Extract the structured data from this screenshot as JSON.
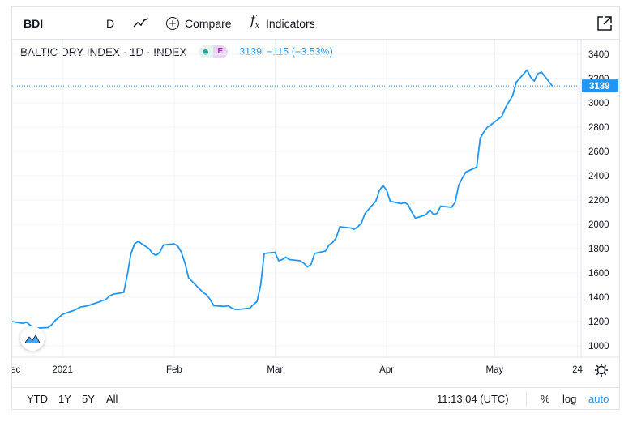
{
  "toolbar": {
    "symbol": "BDI",
    "interval": "D",
    "compare_label": "Compare",
    "indicators_label": "Indicators",
    "chart_type_icon": "line-chart-icon",
    "fullscreen_icon": "external-link-icon"
  },
  "legend": {
    "title": "BALTIC DRY INDEX · 1D · INDEX",
    "badge": "E",
    "last": "3139",
    "change": "−115 (−3.53%)"
  },
  "price_scale": {
    "current_label": "3139"
  },
  "bottom_bar": {
    "ranges": [
      "YTD",
      "1Y",
      "5Y",
      "All"
    ],
    "time": "11:13:04 (UTC)",
    "percent_label": "%",
    "log_label": "log",
    "auto_label": "auto",
    "settings_icon": "gear-icon"
  },
  "colors": {
    "line": "#2196f3",
    "accent": "#2196f3",
    "grid": "#f0f3fa"
  },
  "chart_data": {
    "type": "line",
    "title": "BALTIC DRY INDEX",
    "ylim": [
      900,
      3500
    ],
    "xlim": [
      "2020-12-18",
      "2021-05-25"
    ],
    "yticks": [
      1000,
      1200,
      1400,
      1600,
      1800,
      2000,
      2200,
      2400,
      2600,
      2800,
      3000,
      3200,
      3400
    ],
    "xticks": [
      {
        "date": "2020-12-18",
        "label": "Dec"
      },
      {
        "date": "2021-01-01",
        "label": "2021"
      },
      {
        "date": "2021-02-01",
        "label": "Feb"
      },
      {
        "date": "2021-03-01",
        "label": "Mar"
      },
      {
        "date": "2021-04-01",
        "label": "Apr"
      },
      {
        "date": "2021-05-01",
        "label": "May"
      },
      {
        "date": "2021-05-24",
        "label": "24"
      }
    ],
    "last_value": 3139,
    "series": [
      {
        "values": [
          [
            "2020-12-18",
            1200
          ],
          [
            "2020-12-21",
            1185
          ],
          [
            "2020-12-22",
            1195
          ],
          [
            "2020-12-23",
            1170
          ],
          [
            "2020-12-24",
            1145
          ],
          [
            "2020-12-28",
            1150
          ],
          [
            "2020-12-29",
            1175
          ],
          [
            "2020-12-30",
            1210
          ],
          [
            "2020-12-31",
            1235
          ],
          [
            "2021-01-01",
            1260
          ],
          [
            "2021-01-04",
            1290
          ],
          [
            "2021-01-05",
            1305
          ],
          [
            "2021-01-06",
            1320
          ],
          [
            "2021-01-07",
            1325
          ],
          [
            "2021-01-08",
            1330
          ],
          [
            "2021-01-11",
            1360
          ],
          [
            "2021-01-12",
            1372
          ],
          [
            "2021-01-13",
            1380
          ],
          [
            "2021-01-14",
            1410
          ],
          [
            "2021-01-15",
            1425
          ],
          [
            "2021-01-18",
            1440
          ],
          [
            "2021-01-19",
            1590
          ],
          [
            "2021-01-20",
            1760
          ],
          [
            "2021-01-21",
            1840
          ],
          [
            "2021-01-22",
            1860
          ],
          [
            "2021-01-25",
            1800
          ],
          [
            "2021-01-26",
            1760
          ],
          [
            "2021-01-27",
            1745
          ],
          [
            "2021-01-28",
            1770
          ],
          [
            "2021-01-29",
            1830
          ],
          [
            "2021-02-01",
            1840
          ],
          [
            "2021-02-02",
            1820
          ],
          [
            "2021-02-03",
            1770
          ],
          [
            "2021-02-04",
            1680
          ],
          [
            "2021-02-05",
            1560
          ],
          [
            "2021-02-08",
            1470
          ],
          [
            "2021-02-09",
            1440
          ],
          [
            "2021-02-10",
            1420
          ],
          [
            "2021-02-11",
            1380
          ],
          [
            "2021-02-12",
            1330
          ],
          [
            "2021-02-15",
            1325
          ],
          [
            "2021-02-16",
            1330
          ],
          [
            "2021-02-17",
            1310
          ],
          [
            "2021-02-18",
            1300
          ],
          [
            "2021-02-19",
            1300
          ],
          [
            "2021-02-22",
            1310
          ],
          [
            "2021-02-23",
            1340
          ],
          [
            "2021-02-24",
            1365
          ],
          [
            "2021-02-25",
            1500
          ],
          [
            "2021-02-26",
            1760
          ],
          [
            "2021-03-01",
            1770
          ],
          [
            "2021-03-02",
            1700
          ],
          [
            "2021-03-03",
            1710
          ],
          [
            "2021-03-04",
            1730
          ],
          [
            "2021-03-05",
            1710
          ],
          [
            "2021-03-08",
            1700
          ],
          [
            "2021-03-09",
            1680
          ],
          [
            "2021-03-10",
            1650
          ],
          [
            "2021-03-11",
            1670
          ],
          [
            "2021-03-12",
            1760
          ],
          [
            "2021-03-15",
            1780
          ],
          [
            "2021-03-16",
            1830
          ],
          [
            "2021-03-17",
            1850
          ],
          [
            "2021-03-18",
            1890
          ],
          [
            "2021-03-19",
            1980
          ],
          [
            "2021-03-22",
            1970
          ],
          [
            "2021-03-23",
            1960
          ],
          [
            "2021-03-24",
            1980
          ],
          [
            "2021-03-25",
            2010
          ],
          [
            "2021-03-26",
            2090
          ],
          [
            "2021-03-29",
            2190
          ],
          [
            "2021-03-30",
            2280
          ],
          [
            "2021-03-31",
            2320
          ],
          [
            "2021-04-01",
            2280
          ],
          [
            "2021-04-02",
            2190
          ],
          [
            "2021-04-05",
            2170
          ],
          [
            "2021-04-06",
            2180
          ],
          [
            "2021-04-07",
            2160
          ],
          [
            "2021-04-08",
            2100
          ],
          [
            "2021-04-09",
            2050
          ],
          [
            "2021-04-12",
            2080
          ],
          [
            "2021-04-13",
            2120
          ],
          [
            "2021-04-14",
            2080
          ],
          [
            "2021-04-15",
            2090
          ],
          [
            "2021-04-16",
            2150
          ],
          [
            "2021-04-19",
            2140
          ],
          [
            "2021-04-20",
            2180
          ],
          [
            "2021-04-21",
            2320
          ],
          [
            "2021-04-22",
            2380
          ],
          [
            "2021-04-23",
            2430
          ],
          [
            "2021-04-26",
            2470
          ],
          [
            "2021-04-27",
            2710
          ],
          [
            "2021-04-28",
            2760
          ],
          [
            "2021-04-29",
            2800
          ],
          [
            "2021-04-30",
            2820
          ],
          [
            "2021-05-03",
            2890
          ],
          [
            "2021-05-04",
            2960
          ],
          [
            "2021-05-05",
            3010
          ],
          [
            "2021-05-06",
            3060
          ],
          [
            "2021-05-07",
            3170
          ],
          [
            "2021-05-10",
            3270
          ],
          [
            "2021-05-11",
            3210
          ],
          [
            "2021-05-12",
            3180
          ],
          [
            "2021-05-13",
            3240
          ],
          [
            "2021-05-14",
            3254
          ],
          [
            "2021-05-17",
            3139
          ]
        ]
      }
    ]
  }
}
